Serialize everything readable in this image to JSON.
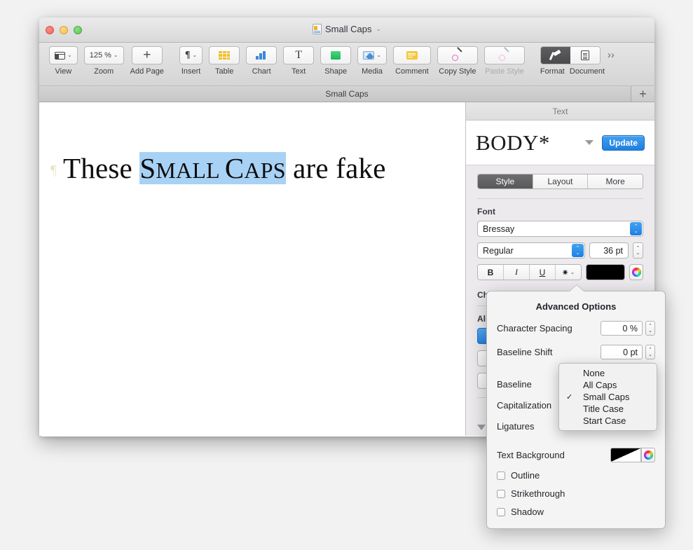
{
  "window": {
    "title": "Small Caps",
    "doc_icon": "pages-document-icon",
    "title_chevron": "⌄"
  },
  "toolbar": {
    "items": [
      {
        "label": "View",
        "icon": "view-layout-icon",
        "has_chevron": true,
        "dim": false
      },
      {
        "label": "Zoom",
        "icon": "zoom-level-text",
        "value": "125 %",
        "has_chevron": true,
        "dim": false
      },
      {
        "label": "Add Page",
        "icon": "plus-icon",
        "has_chevron": false,
        "dim": false
      },
      {
        "label": "Insert",
        "icon": "pilcrow-icon",
        "has_chevron": true,
        "dim": false
      },
      {
        "label": "Table",
        "icon": "table-icon",
        "has_chevron": false,
        "dim": false
      },
      {
        "label": "Chart",
        "icon": "bar-chart-icon",
        "has_chevron": false,
        "dim": false
      },
      {
        "label": "Text",
        "icon": "text-t-icon",
        "has_chevron": false,
        "dim": false
      },
      {
        "label": "Shape",
        "icon": "shape-icon",
        "has_chevron": false,
        "dim": false
      },
      {
        "label": "Media",
        "icon": "media-photo-icon",
        "has_chevron": true,
        "dim": false
      },
      {
        "label": "Comment",
        "icon": "comment-note-icon",
        "has_chevron": false,
        "dim": false
      },
      {
        "label": "Copy Style",
        "icon": "eyedropper-icon",
        "has_chevron": false,
        "dim": false
      },
      {
        "label": "Paste Style",
        "icon": "eyedropper-icon",
        "has_chevron": false,
        "dim": true
      }
    ],
    "segmented": {
      "format_label": "Format",
      "format_icon": "format-brush-icon",
      "format_selected": true,
      "document_label": "Document",
      "document_icon": "document-page-icon",
      "document_selected": false
    },
    "overflow_glyph": "›› "
  },
  "tabbar": {
    "title": "Small Caps",
    "add_glyph": "+"
  },
  "canvas": {
    "text_before": "These ",
    "text_highlight_first": "S",
    "text_highlight_rest": "MALL ",
    "text_highlight_first2": "C",
    "text_highlight_rest2": "APS",
    "text_after": " are fake",
    "highlight_color": "#a8d2f5",
    "paragraph_mark": "¶"
  },
  "inspector": {
    "header": "Text",
    "style_name": "BODY*",
    "update_label": "Update",
    "tabs": [
      {
        "label": "Style",
        "selected": true
      },
      {
        "label": "Layout",
        "selected": false
      },
      {
        "label": "More",
        "selected": false
      }
    ],
    "font_section_label": "Font",
    "font_family": "Bressay",
    "font_weight": "Regular",
    "font_size": "36 pt",
    "bold_label": "B",
    "italic_label": "I",
    "underline_label": "U",
    "gear_glyph": "✿",
    "gear_chevron": "⌄",
    "text_color": "#000000",
    "character_styles_label": "Ch",
    "alignment_label": "Ali"
  },
  "popover": {
    "title": "Advanced Options",
    "rows": [
      {
        "label": "Character Spacing",
        "value": "0 %"
      },
      {
        "label": "Baseline Shift",
        "value": "0 pt"
      }
    ],
    "option_labels": [
      "Baseline",
      "Capitalization",
      "Ligatures"
    ],
    "text_background_label": "Text Background",
    "checkboxes": [
      {
        "label": "Outline",
        "checked": false
      },
      {
        "label": "Strikethrough",
        "checked": false
      },
      {
        "label": "Shadow",
        "checked": false
      }
    ]
  },
  "dropdown": {
    "items": [
      {
        "label": "None",
        "checked": false
      },
      {
        "label": "All Caps",
        "checked": false
      },
      {
        "label": "Small Caps",
        "checked": true
      },
      {
        "label": "Title Case",
        "checked": false
      },
      {
        "label": "Start Case",
        "checked": false
      }
    ],
    "check_glyph": "✓"
  }
}
